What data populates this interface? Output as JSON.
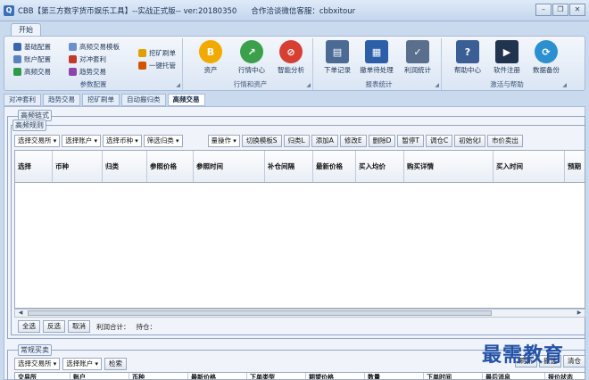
{
  "window": {
    "title": "CBB【第三方数字货币娱乐工具】--实战正式版-- ver:20180350",
    "contact": "合作洽谈微信客服：cbbxitour",
    "app_icon": "Q",
    "controls": [
      "minimize",
      "restore",
      "close"
    ]
  },
  "ribbon_tab": "开始",
  "ribbon": {
    "group1": {
      "label": "参数配置",
      "items": [
        "基础配置",
        "账户配置",
        "高频交易",
        "高频交易模板",
        "对冲套利",
        "趋势交易",
        "挖矿刷单",
        "一键托管"
      ]
    },
    "group2": {
      "label": "行情和资产",
      "items": [
        "资产",
        "行情中心",
        "智能分析"
      ]
    },
    "group3": {
      "label": "报表统计",
      "items": [
        "下单记录",
        "撤单待处理",
        "利润统计"
      ]
    },
    "group4": {
      "label": "激活与帮助",
      "items": [
        "帮助中心",
        "软件注册",
        "数据备份"
      ]
    }
  },
  "module_tabs": [
    "对冲套利",
    "趋势交易",
    "挖矿刷单",
    "自动搬归类",
    "高频交易"
  ],
  "panel": {
    "outer_legend": "高频链式",
    "inner_legend": "高频规则",
    "toolbar_dropdowns": [
      "选择交易所",
      "选择账户",
      "选择币种",
      "筛选归类"
    ],
    "toolbar_buttons": [
      "量操作",
      "切换模板S",
      "归类L",
      "添加A",
      "修改E",
      "删除D",
      "暂停T",
      "调仓C",
      "初始化I",
      "市价卖出"
    ],
    "columns": [
      "选择",
      "币种",
      "归类",
      "参照价格",
      "参照时间",
      "补仓间隔",
      "最新价格",
      "买入均价",
      "购买详情",
      "买入时间",
      "预期"
    ],
    "bottom_buttons": [
      "全选",
      "反选",
      "取消"
    ],
    "profit_label": "利润合计：",
    "position_label": "持仓："
  },
  "section2": {
    "legend": "常规买卖",
    "dropdowns": [
      "选择交易所",
      "选择账户"
    ],
    "button": "检索",
    "right_buttons": [
      "刷新",
      "撤选",
      "清仓"
    ],
    "columns": [
      "交易所",
      "账户",
      "币种",
      "最新价格",
      "下单类型",
      "期望价格",
      "数量",
      "下单时间",
      "最后消息",
      "报价状态"
    ]
  },
  "watermark": "最需教育"
}
